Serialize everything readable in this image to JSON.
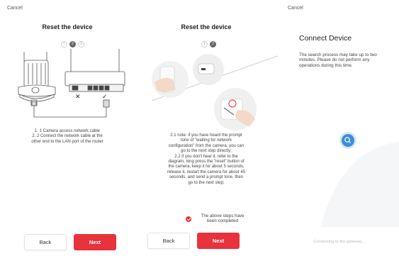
{
  "panel1": {
    "cancel": "Cancel",
    "title": "Reset the device",
    "steps": [
      "1",
      "2",
      "3"
    ],
    "desc_line1": "1. 1 Camera access network cable",
    "desc_line2": "2. 2 Connect the network cable at the",
    "desc_line3": "other end to the LAN port of the router",
    "back": "Back",
    "next": "Next"
  },
  "panel2": {
    "title": "Reset the device",
    "steps": [
      "1",
      "2"
    ],
    "note": [
      "2.1 note: if you have heard the prompt",
      "tone of \"waiting for network",
      "configuration\" from the camera, you can",
      "go to the next step directly;",
      "2.2 if you don't hear it, refer to the",
      "diagram, long press the \"reset\" button of",
      "the camera, keep it for about 5 seconds,",
      "release it, restart the camera for about 45",
      "seconds, and send a prompt tone, then",
      "go to the next step;"
    ],
    "confirm_line1": "The above steps have",
    "confirm_line2": "been completed",
    "back": "Back",
    "next": "Next"
  },
  "panel3": {
    "cancel": "Cancel",
    "title": "Connect Device",
    "desc_line1": "The search process may take up to two",
    "desc_line2": "minutes. Please do not perform any",
    "desc_line3": "operations during this time.",
    "status": "Connecting to the gateway..."
  },
  "colors": {
    "accent": "#e8323c",
    "search_blue": "#3b8fd9"
  },
  "icons": [
    "camera-icon",
    "router-icon",
    "search-icon",
    "check-icon"
  ]
}
